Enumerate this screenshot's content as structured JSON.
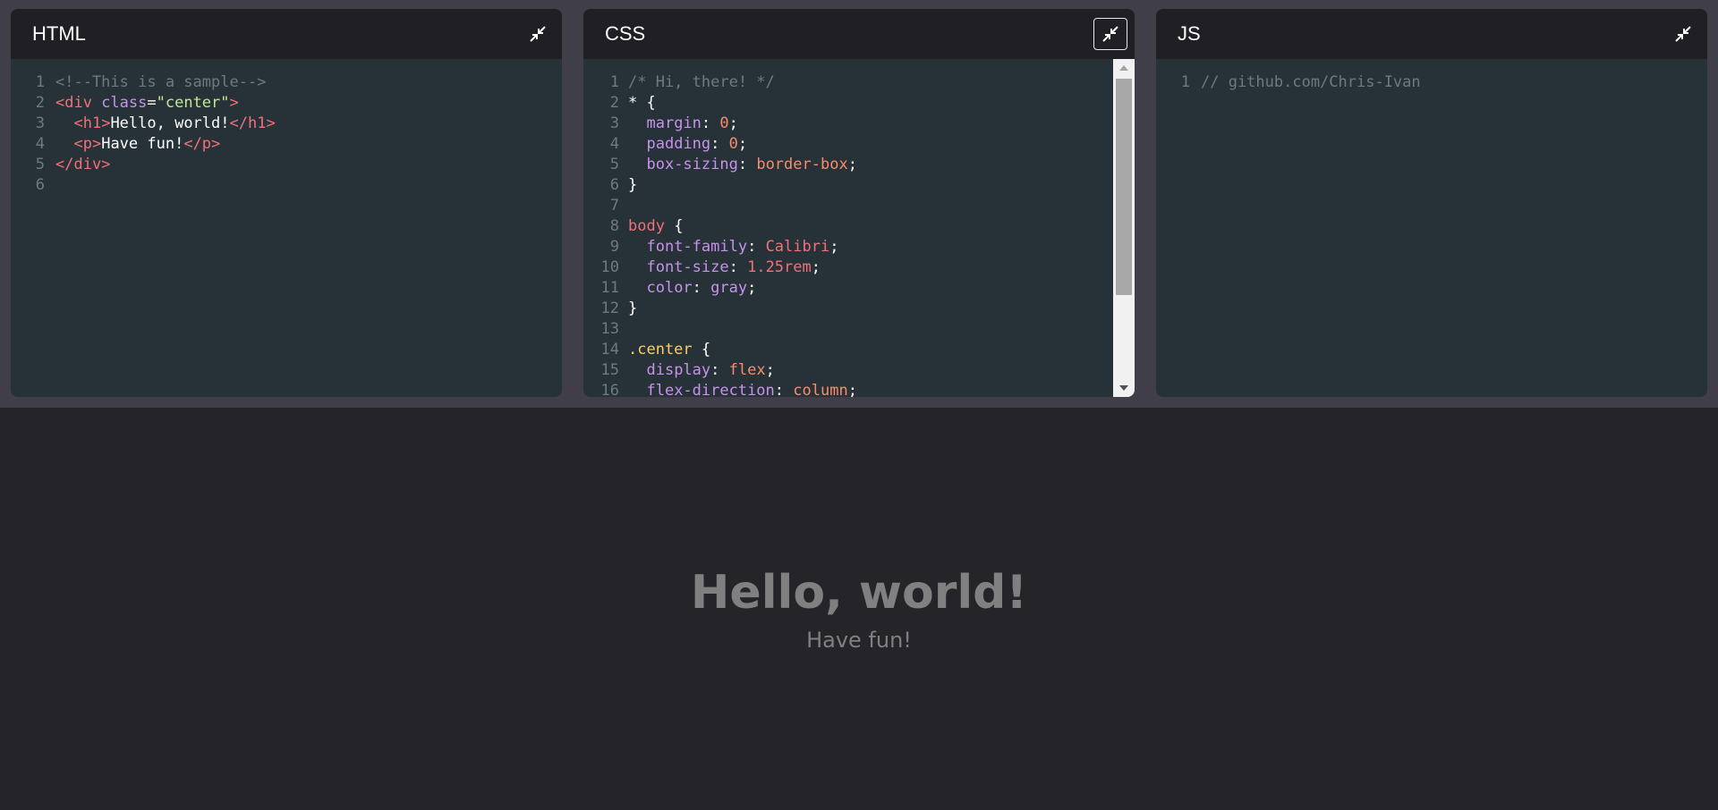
{
  "panels": {
    "html": {
      "title": "HTML",
      "lines": [
        [
          {
            "t": "<!--This is a sample-->",
            "c": "comment"
          }
        ],
        [
          {
            "t": "<div ",
            "c": "tag"
          },
          {
            "t": "class",
            "c": "attr"
          },
          {
            "t": "=",
            "c": "text"
          },
          {
            "t": "\"center\"",
            "c": "str"
          },
          {
            "t": ">",
            "c": "tag"
          }
        ],
        [
          {
            "t": "  ",
            "c": "text"
          },
          {
            "t": "<h1>",
            "c": "tag"
          },
          {
            "t": "Hello, world!",
            "c": "text"
          },
          {
            "t": "</h1>",
            "c": "tag"
          }
        ],
        [
          {
            "t": "  ",
            "c": "text"
          },
          {
            "t": "<p>",
            "c": "tag"
          },
          {
            "t": "Have fun!",
            "c": "text"
          },
          {
            "t": "</p>",
            "c": "tag"
          }
        ],
        [
          {
            "t": "</div>",
            "c": "tag"
          }
        ],
        []
      ]
    },
    "css": {
      "title": "CSS",
      "lines": [
        [
          {
            "t": "/* Hi, there! */",
            "c": "comment"
          }
        ],
        [
          {
            "t": "* {",
            "c": "punc"
          }
        ],
        [
          {
            "t": "  ",
            "c": "text"
          },
          {
            "t": "margin",
            "c": "prop"
          },
          {
            "t": ": ",
            "c": "punc"
          },
          {
            "t": "0",
            "c": "num"
          },
          {
            "t": ";",
            "c": "punc"
          }
        ],
        [
          {
            "t": "  ",
            "c": "text"
          },
          {
            "t": "padding",
            "c": "prop"
          },
          {
            "t": ": ",
            "c": "punc"
          },
          {
            "t": "0",
            "c": "num"
          },
          {
            "t": ";",
            "c": "punc"
          }
        ],
        [
          {
            "t": "  ",
            "c": "text"
          },
          {
            "t": "box-sizing",
            "c": "prop"
          },
          {
            "t": ": ",
            "c": "punc"
          },
          {
            "t": "border-box",
            "c": "val"
          },
          {
            "t": ";",
            "c": "punc"
          }
        ],
        [
          {
            "t": "}",
            "c": "punc"
          }
        ],
        [],
        [
          {
            "t": "body",
            "c": "sel"
          },
          {
            "t": " {",
            "c": "punc"
          }
        ],
        [
          {
            "t": "  ",
            "c": "text"
          },
          {
            "t": "font-family",
            "c": "prop"
          },
          {
            "t": ": ",
            "c": "punc"
          },
          {
            "t": "Calibri",
            "c": "sel"
          },
          {
            "t": ";",
            "c": "punc"
          }
        ],
        [
          {
            "t": "  ",
            "c": "text"
          },
          {
            "t": "font-size",
            "c": "prop"
          },
          {
            "t": ": ",
            "c": "punc"
          },
          {
            "t": "1.25rem",
            "c": "sel"
          },
          {
            "t": ";",
            "c": "punc"
          }
        ],
        [
          {
            "t": "  ",
            "c": "text"
          },
          {
            "t": "color",
            "c": "prop"
          },
          {
            "t": ": ",
            "c": "punc"
          },
          {
            "t": "gray",
            "c": "attr"
          },
          {
            "t": ";",
            "c": "punc"
          }
        ],
        [
          {
            "t": "}",
            "c": "punc"
          }
        ],
        [],
        [
          {
            "t": ".center",
            "c": "cls"
          },
          {
            "t": " {",
            "c": "punc"
          }
        ],
        [
          {
            "t": "  ",
            "c": "text"
          },
          {
            "t": "display",
            "c": "prop"
          },
          {
            "t": ": ",
            "c": "punc"
          },
          {
            "t": "flex",
            "c": "val"
          },
          {
            "t": ";",
            "c": "punc"
          }
        ],
        [
          {
            "t": "  ",
            "c": "text"
          },
          {
            "t": "flex-direction",
            "c": "prop"
          },
          {
            "t": ": ",
            "c": "punc"
          },
          {
            "t": "column",
            "c": "val"
          },
          {
            "t": ";",
            "c": "punc"
          }
        ]
      ]
    },
    "js": {
      "title": "JS",
      "lines": [
        [
          {
            "t": "// github.com/Chris-Ivan",
            "c": "comment"
          }
        ]
      ]
    }
  },
  "preview": {
    "heading": "Hello, world!",
    "text": "Have fun!"
  },
  "icons": {
    "toggle": "compress-arrows-icon",
    "scroll_up": "arrow-up-icon",
    "scroll_down": "arrow-down-icon"
  },
  "colors": {
    "page_background": "#242429",
    "editor_strip": "#403e48",
    "panel_header": "#1f1f24",
    "code_background": "#263238",
    "preview_text": "#808080"
  }
}
